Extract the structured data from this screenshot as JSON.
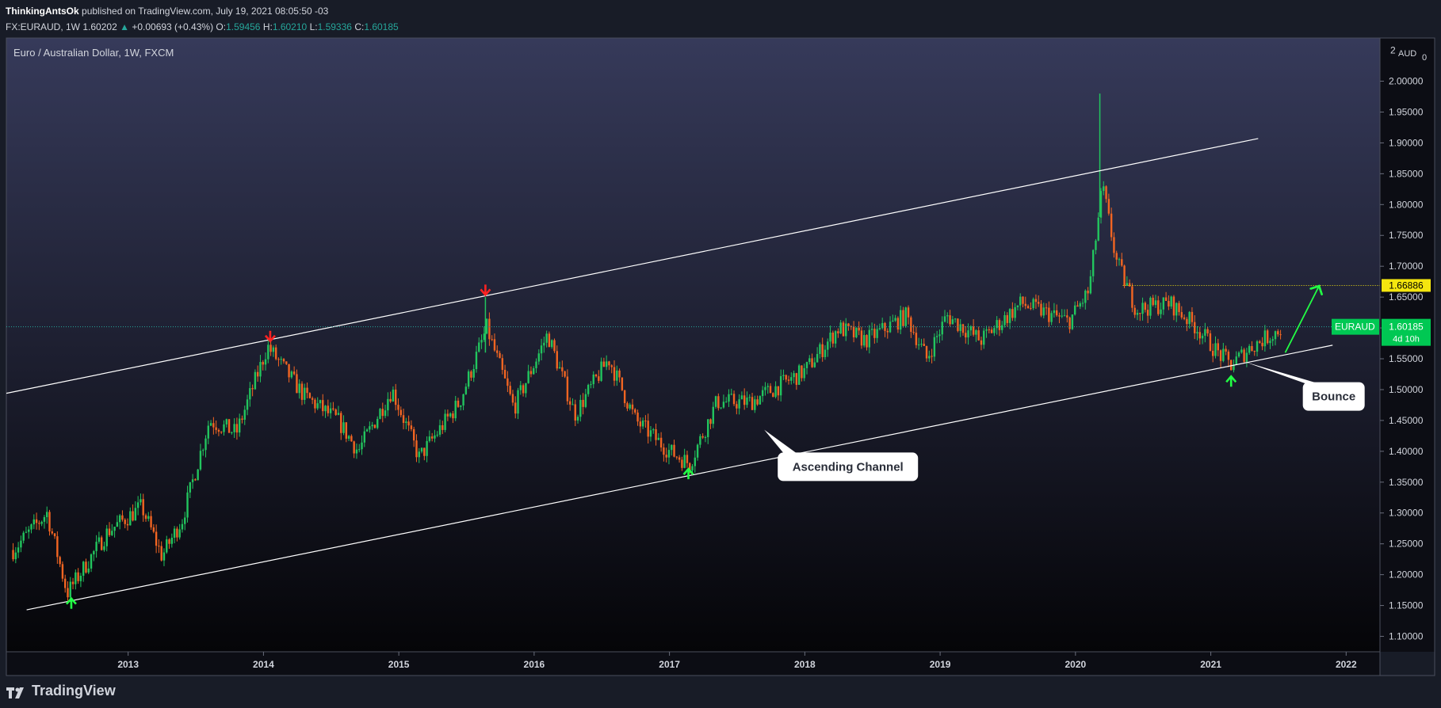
{
  "header": {
    "author": "ThinkingAntsOk",
    "published": "published on TradingView.com, July 19, 2021 08:05:50 -03",
    "symbol": "FX:EURAUD, 1W",
    "last": "1.60202",
    "change": "+0.00693 (+0.43%)",
    "o_label": "O:",
    "o": "1.59456",
    "h_label": "H:",
    "h": "1.60210",
    "l_label": "L:",
    "l": "1.59336",
    "c_label": "C:",
    "c": "1.60185"
  },
  "chart_title": "Euro / Australian Dollar, 1W, FXCM",
  "axis_currency": "AUD",
  "footer_logo": "TradingView",
  "colors": {
    "background_top": "#363a5a",
    "background_bottom": "#050508",
    "up": "#22c55e",
    "down": "#f26522",
    "channel": "#ffffff",
    "resistance": "#f5e60f",
    "price_line": "#26a69a",
    "price_label": "#00c853",
    "arrow_up": "#22ff44",
    "arrow_down": "#ff2222"
  },
  "chart_data": {
    "type": "candlestick",
    "title": "Euro / Australian Dollar, 1W, FXCM",
    "x_ticks": [
      "2013",
      "2014",
      "2015",
      "2016",
      "2017",
      "2018",
      "2019",
      "2020",
      "2021",
      "2022"
    ],
    "y_ticks": [
      "2.00000",
      "1.95000",
      "1.90000",
      "1.85000",
      "1.80000",
      "1.75000",
      "1.70000",
      "1.65000",
      "1.60000",
      "1.55000",
      "1.50000",
      "1.45000",
      "1.40000",
      "1.35000",
      "1.30000",
      "1.25000",
      "1.20000",
      "1.15000",
      "1.10000"
    ],
    "y_top_tick": "2",
    "x_range": [
      2012.1,
      2022.25
    ],
    "y_range": [
      1.075,
      2.07
    ],
    "key_points": [
      {
        "x": 2012.15,
        "y": 1.24
      },
      {
        "x": 2012.4,
        "y": 1.3
      },
      {
        "x": 2012.55,
        "y": 1.17
      },
      {
        "x": 2012.85,
        "y": 1.27
      },
      {
        "x": 2013.1,
        "y": 1.31
      },
      {
        "x": 2013.25,
        "y": 1.23
      },
      {
        "x": 2013.4,
        "y": 1.29
      },
      {
        "x": 2013.6,
        "y": 1.45
      },
      {
        "x": 2013.8,
        "y": 1.43
      },
      {
        "x": 2014.03,
        "y": 1.57
      },
      {
        "x": 2014.3,
        "y": 1.49
      },
      {
        "x": 2014.55,
        "y": 1.45
      },
      {
        "x": 2014.7,
        "y": 1.4
      },
      {
        "x": 2014.95,
        "y": 1.5
      },
      {
        "x": 2015.15,
        "y": 1.39
      },
      {
        "x": 2015.45,
        "y": 1.48
      },
      {
        "x": 2015.65,
        "y": 1.6
      },
      {
        "x": 2015.85,
        "y": 1.47
      },
      {
        "x": 2016.1,
        "y": 1.59
      },
      {
        "x": 2016.3,
        "y": 1.46
      },
      {
        "x": 2016.55,
        "y": 1.55
      },
      {
        "x": 2016.75,
        "y": 1.45
      },
      {
        "x": 2017.0,
        "y": 1.4
      },
      {
        "x": 2017.15,
        "y": 1.38
      },
      {
        "x": 2017.35,
        "y": 1.48
      },
      {
        "x": 2017.6,
        "y": 1.48
      },
      {
        "x": 2018.0,
        "y": 1.53
      },
      {
        "x": 2018.25,
        "y": 1.6
      },
      {
        "x": 2018.45,
        "y": 1.58
      },
      {
        "x": 2018.75,
        "y": 1.62
      },
      {
        "x": 2018.9,
        "y": 1.55
      },
      {
        "x": 2019.05,
        "y": 1.62
      },
      {
        "x": 2019.3,
        "y": 1.58
      },
      {
        "x": 2019.6,
        "y": 1.64
      },
      {
        "x": 2019.95,
        "y": 1.61
      },
      {
        "x": 2020.1,
        "y": 1.66
      },
      {
        "x": 2020.2,
        "y": 1.83
      },
      {
        "x": 2020.3,
        "y": 1.71
      },
      {
        "x": 2020.45,
        "y": 1.63
      },
      {
        "x": 2020.7,
        "y": 1.64
      },
      {
        "x": 2020.9,
        "y": 1.6
      },
      {
        "x": 2021.05,
        "y": 1.56
      },
      {
        "x": 2021.15,
        "y": 1.54
      },
      {
        "x": 2021.3,
        "y": 1.57
      },
      {
        "x": 2021.53,
        "y": 1.6
      }
    ],
    "spikes": [
      {
        "x": 2020.18,
        "high": 1.98,
        "low": 1.78
      },
      {
        "x": 2015.64,
        "high": 1.65,
        "low": 1.56
      }
    ],
    "channel_upper": {
      "x1": 2012.1,
      "y1": 1.494,
      "x2": 2021.35,
      "y2": 1.907
    },
    "channel_lower": {
      "x1": 2012.25,
      "y1": 1.143,
      "x2": 2021.9,
      "y2": 1.572
    },
    "resistance_level": 1.66886,
    "resistance_label": "1.66886",
    "resistance_from_x": 2020.35,
    "last_price": 1.60185,
    "last_price_label": "EURAUD",
    "last_price_value": "1.60185",
    "last_price_timer": "4d 10h",
    "projection_arrow": {
      "x1": 2021.55,
      "y1": 1.56,
      "x2": 2021.8,
      "y2": 1.668
    },
    "markers": [
      {
        "type": "up",
        "x": 2012.58,
        "y": 1.155
      },
      {
        "type": "up",
        "x": 2017.14,
        "y": 1.365
      },
      {
        "type": "up",
        "x": 2021.15,
        "y": 1.515
      },
      {
        "type": "down",
        "x": 2014.05,
        "y": 1.585
      },
      {
        "type": "down",
        "x": 2015.64,
        "y": 1.66
      }
    ],
    "annotations": [
      {
        "text": "Ascending Channel",
        "box_x": 2017.8,
        "box_y": 1.398,
        "tip_x": 2017.7,
        "tip_y": 1.435
      },
      {
        "text": "Bounce",
        "box_x": 2021.68,
        "box_y": 1.512,
        "tip_x": 2021.25,
        "tip_y": 1.545
      }
    ]
  }
}
